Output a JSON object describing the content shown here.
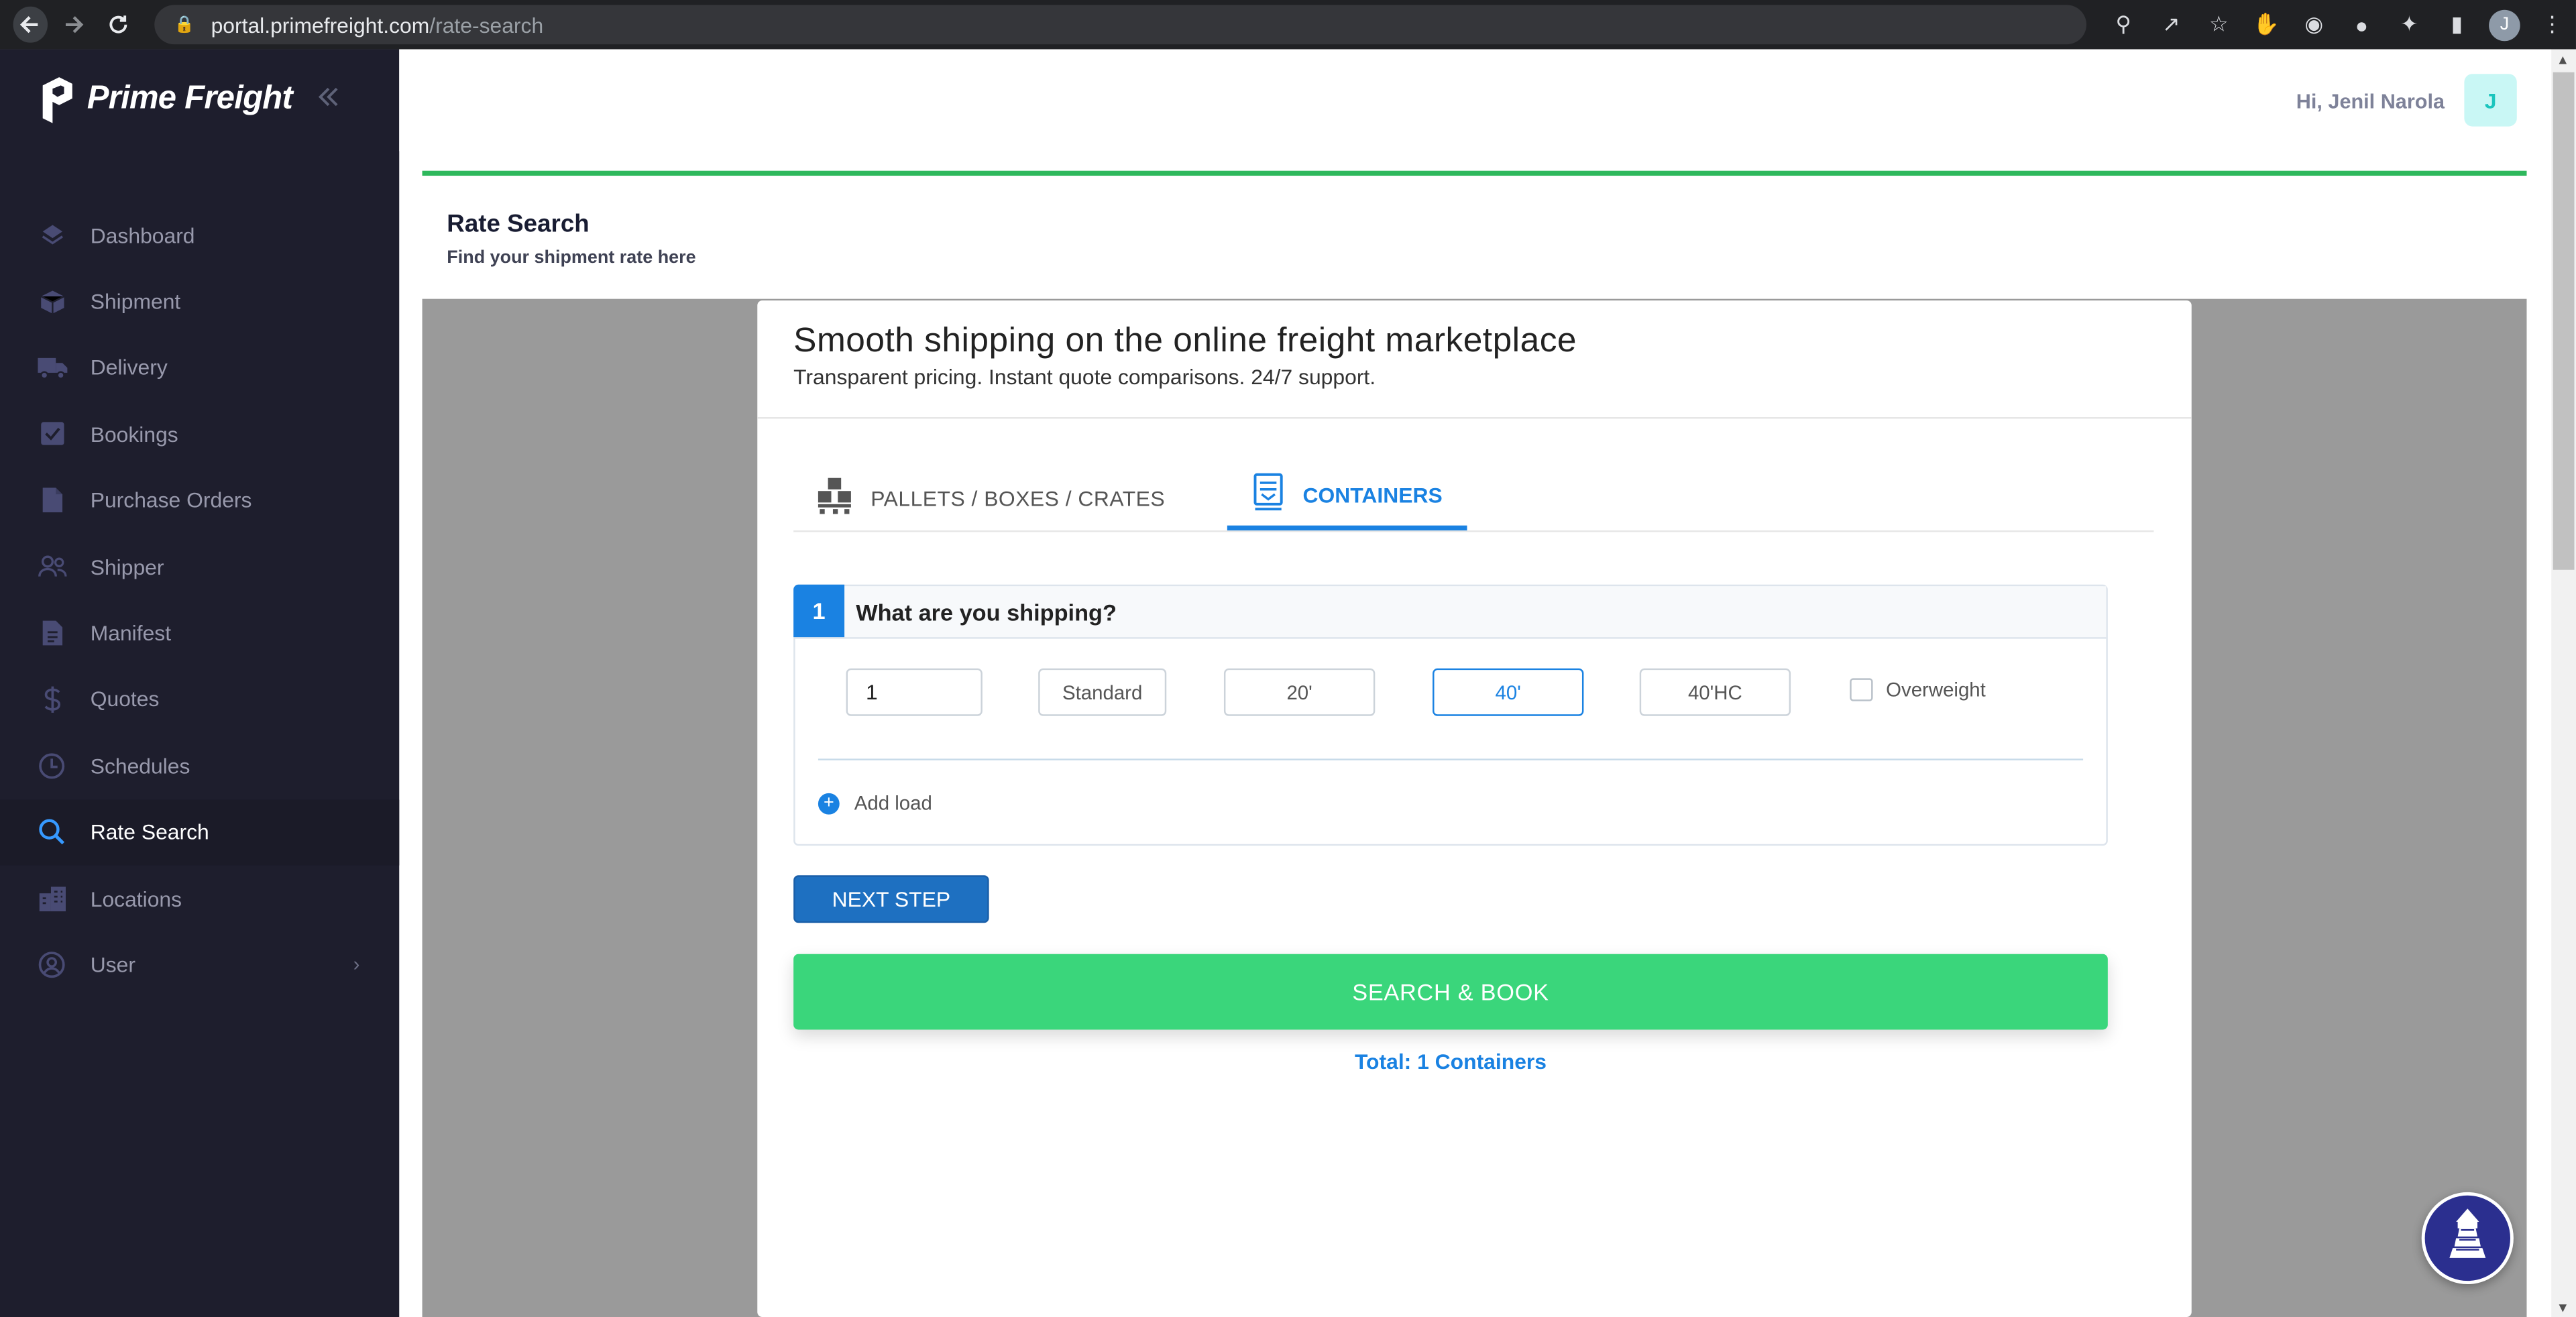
{
  "browser": {
    "url_domain": "portal.primefreight.com",
    "url_path": "/rate-search",
    "profile_initial": "J"
  },
  "brand": {
    "name": "Prime Freight"
  },
  "sidebar": {
    "items": [
      {
        "label": "Dashboard",
        "icon": "layers-icon"
      },
      {
        "label": "Shipment",
        "icon": "box-icon"
      },
      {
        "label": "Delivery",
        "icon": "truck-icon"
      },
      {
        "label": "Bookings",
        "icon": "checkbox-icon"
      },
      {
        "label": "Purchase Orders",
        "icon": "document-icon"
      },
      {
        "label": "Shipper",
        "icon": "users-icon"
      },
      {
        "label": "Manifest",
        "icon": "file-text-icon"
      },
      {
        "label": "Quotes",
        "icon": "dollar-icon"
      },
      {
        "label": "Schedules",
        "icon": "clock-icon"
      },
      {
        "label": "Rate Search",
        "icon": "search-icon",
        "active": true
      },
      {
        "label": "Locations",
        "icon": "building-icon"
      },
      {
        "label": "User",
        "icon": "user-circle-icon"
      }
    ]
  },
  "header": {
    "greeting": "Hi, Jenil Narola",
    "avatar_initial": "J"
  },
  "page": {
    "title": "Rate Search",
    "subtitle": "Find your shipment rate here"
  },
  "card": {
    "hero_title": "Smooth shipping on the online freight marketplace",
    "hero_subtitle": "Transparent pricing. Instant quote comparisons. 24/7 support.",
    "tabs": [
      {
        "label": "PALLETS / BOXES / CRATES",
        "active": false
      },
      {
        "label": "CONTAINERS",
        "active": true
      }
    ],
    "step": {
      "number": "1",
      "title": "What are you shipping?",
      "quantity": "1",
      "type": "Standard",
      "sizes": [
        "20'",
        "40'",
        "40'HC"
      ],
      "selected_size": "40'",
      "overweight_label": "Overweight",
      "overweight_checked": false,
      "add_load": "Add load"
    },
    "next_step": "NEXT STEP",
    "search_book": "SEARCH & BOOK",
    "total": "Total: 1 Containers"
  },
  "colors": {
    "sidebar_bg": "#1e1e2d",
    "accent_blue": "#1a82e2",
    "green_button": "#3ad67b",
    "header_border": "#2eb85c"
  }
}
